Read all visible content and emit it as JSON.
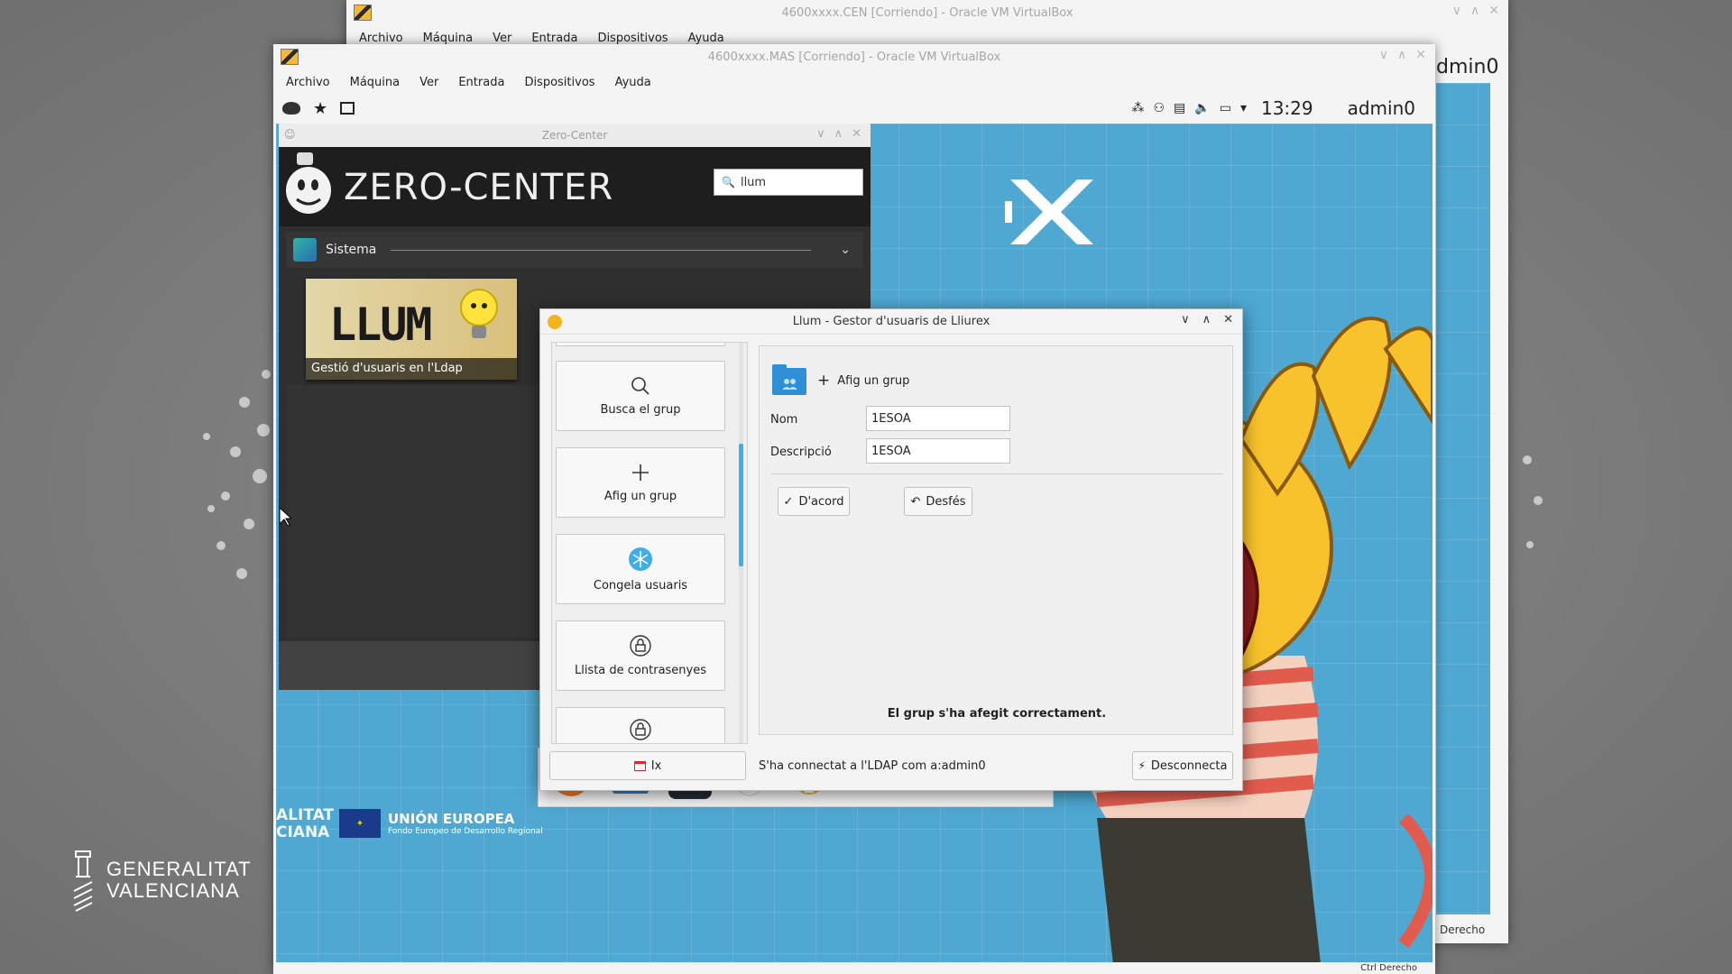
{
  "vm_back": {
    "title": "4600xxxx.CEN [Corriendo] - Oracle VM VirtualBox",
    "menu": [
      "Archivo",
      "Máquina",
      "Ver",
      "Entrada",
      "Dispositivos",
      "Ayuda"
    ],
    "user_fragment": "dmin0",
    "status_fragment": "Derecho"
  },
  "vm_front": {
    "title": "4600xxxx.MAS [Corriendo] - Oracle VM VirtualBox",
    "menu": [
      "Archivo",
      "Máquina",
      "Ver",
      "Entrada",
      "Dispositivos",
      "Ayuda"
    ],
    "clock": "13:29",
    "user": "admin0",
    "status_fragment": "Ctrl Derecho"
  },
  "zero_center": {
    "window_title": "Zero-Center",
    "brand": "ZERO-CENTER",
    "search_value": "llum",
    "category": "Sistema",
    "tile_title": "LLUM",
    "tile_caption": "Gestió d'usuaris en l'Ldap"
  },
  "llum": {
    "title": "Llum - Gestor d'usuaris de Lliurex",
    "sidebar": [
      {
        "label": "Busca el grup",
        "icon": "search-icon"
      },
      {
        "label": "Afig un grup",
        "icon": "plus-icon"
      },
      {
        "label": "Congela usuaris",
        "icon": "snowflake-icon"
      },
      {
        "label": "Llista de contrasenyes",
        "icon": "lock-icon"
      },
      {
        "label": "",
        "icon": "lock-icon"
      }
    ],
    "exit_label": "Ix",
    "panel_heading": "Afig un grup",
    "nom_label": "Nom",
    "nom_value": "1ESOA",
    "desc_label": "Descripció",
    "desc_value": "1ESOA",
    "ok_label": "D'acord",
    "undo_label": "Desfés",
    "message": "El grup s'ha afegit correctament.",
    "status": "S'ha connectat a l'LDAP com a:admin0",
    "disconnect_label": "Desconnecta"
  },
  "desktop": {
    "brand_line1": "GENERALITAT",
    "brand_line2": "VALENCIANA",
    "eu_line1": "UNIÓN EUROPEA",
    "eu_line2": "Fondo Europeo de Desarrollo Regional",
    "gv_fragment_1": "ALITAT",
    "gv_fragment_2": "CIANA"
  },
  "colors": {
    "accent": "#3daee9",
    "desktop_blue": "#4ea8d2",
    "zc_dark": "#2f2f2f"
  }
}
